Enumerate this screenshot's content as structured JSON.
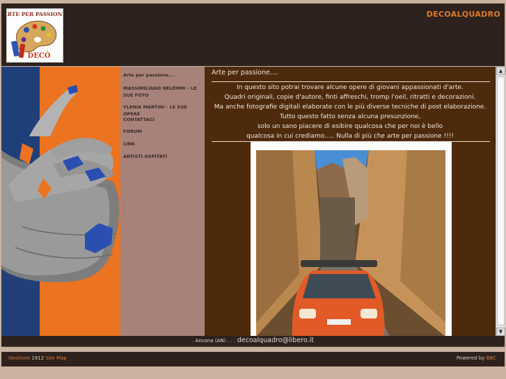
{
  "header": {
    "site_title": "DECOALQUADRO",
    "logo": {
      "text_top": "ARTE PER PASSIONE",
      "text_bottom": "DECÒ"
    }
  },
  "sidebar": {
    "items": [
      {
        "label": "Arte per passione...."
      },
      {
        "label": "MASSIMILIANO BELEMMI - LE SUE FOTO"
      },
      {
        "label": "YLENIA MARTINI - LE SUE OPERE"
      },
      {
        "label": "CONTATTACI"
      },
      {
        "label": "FORUM"
      },
      {
        "label": "LINK"
      },
      {
        "label": "ARTISTI OSPITATI"
      }
    ]
  },
  "content": {
    "title": "Arte per passione....",
    "intro_lines": [
      "In questo sito potrai trovare alcune opere di giovani appassionati d'arte.",
      "Quadri originali, copie d'autore, finti affreschi, tromp l'oeil, ritratti e decorazioni.",
      "Ma anche fotografie digitali elaborate con le più diverse tecniche di post elaborazione.",
      "Tutto questo fatto senza alcuna presunzione,",
      "solo un sano piacere di esibire qualcosa che per noi è bello",
      "qualcosa in cui crediamo..... Nulla di più che arte per passione !!!!"
    ]
  },
  "contact": {
    "prefix": ". Ancona (AN) . . .",
    "email": "decoalquadro@libero.it"
  },
  "footer": {
    "left_text": "Gestione",
    "count": "1912",
    "sitemap": "Site Map",
    "powered_text": "Powered by",
    "powered_link": "BBC"
  },
  "colors": {
    "accent": "#e07a2a",
    "dark_bg": "#2d221d",
    "sidebar_bg": "#a8827a",
    "content_bg": "#4d2a0c",
    "page_bg": "#cbb3a1"
  },
  "icons": {
    "scroll_up": "arrow-up-icon",
    "scroll_down": "arrow-down-icon"
  }
}
